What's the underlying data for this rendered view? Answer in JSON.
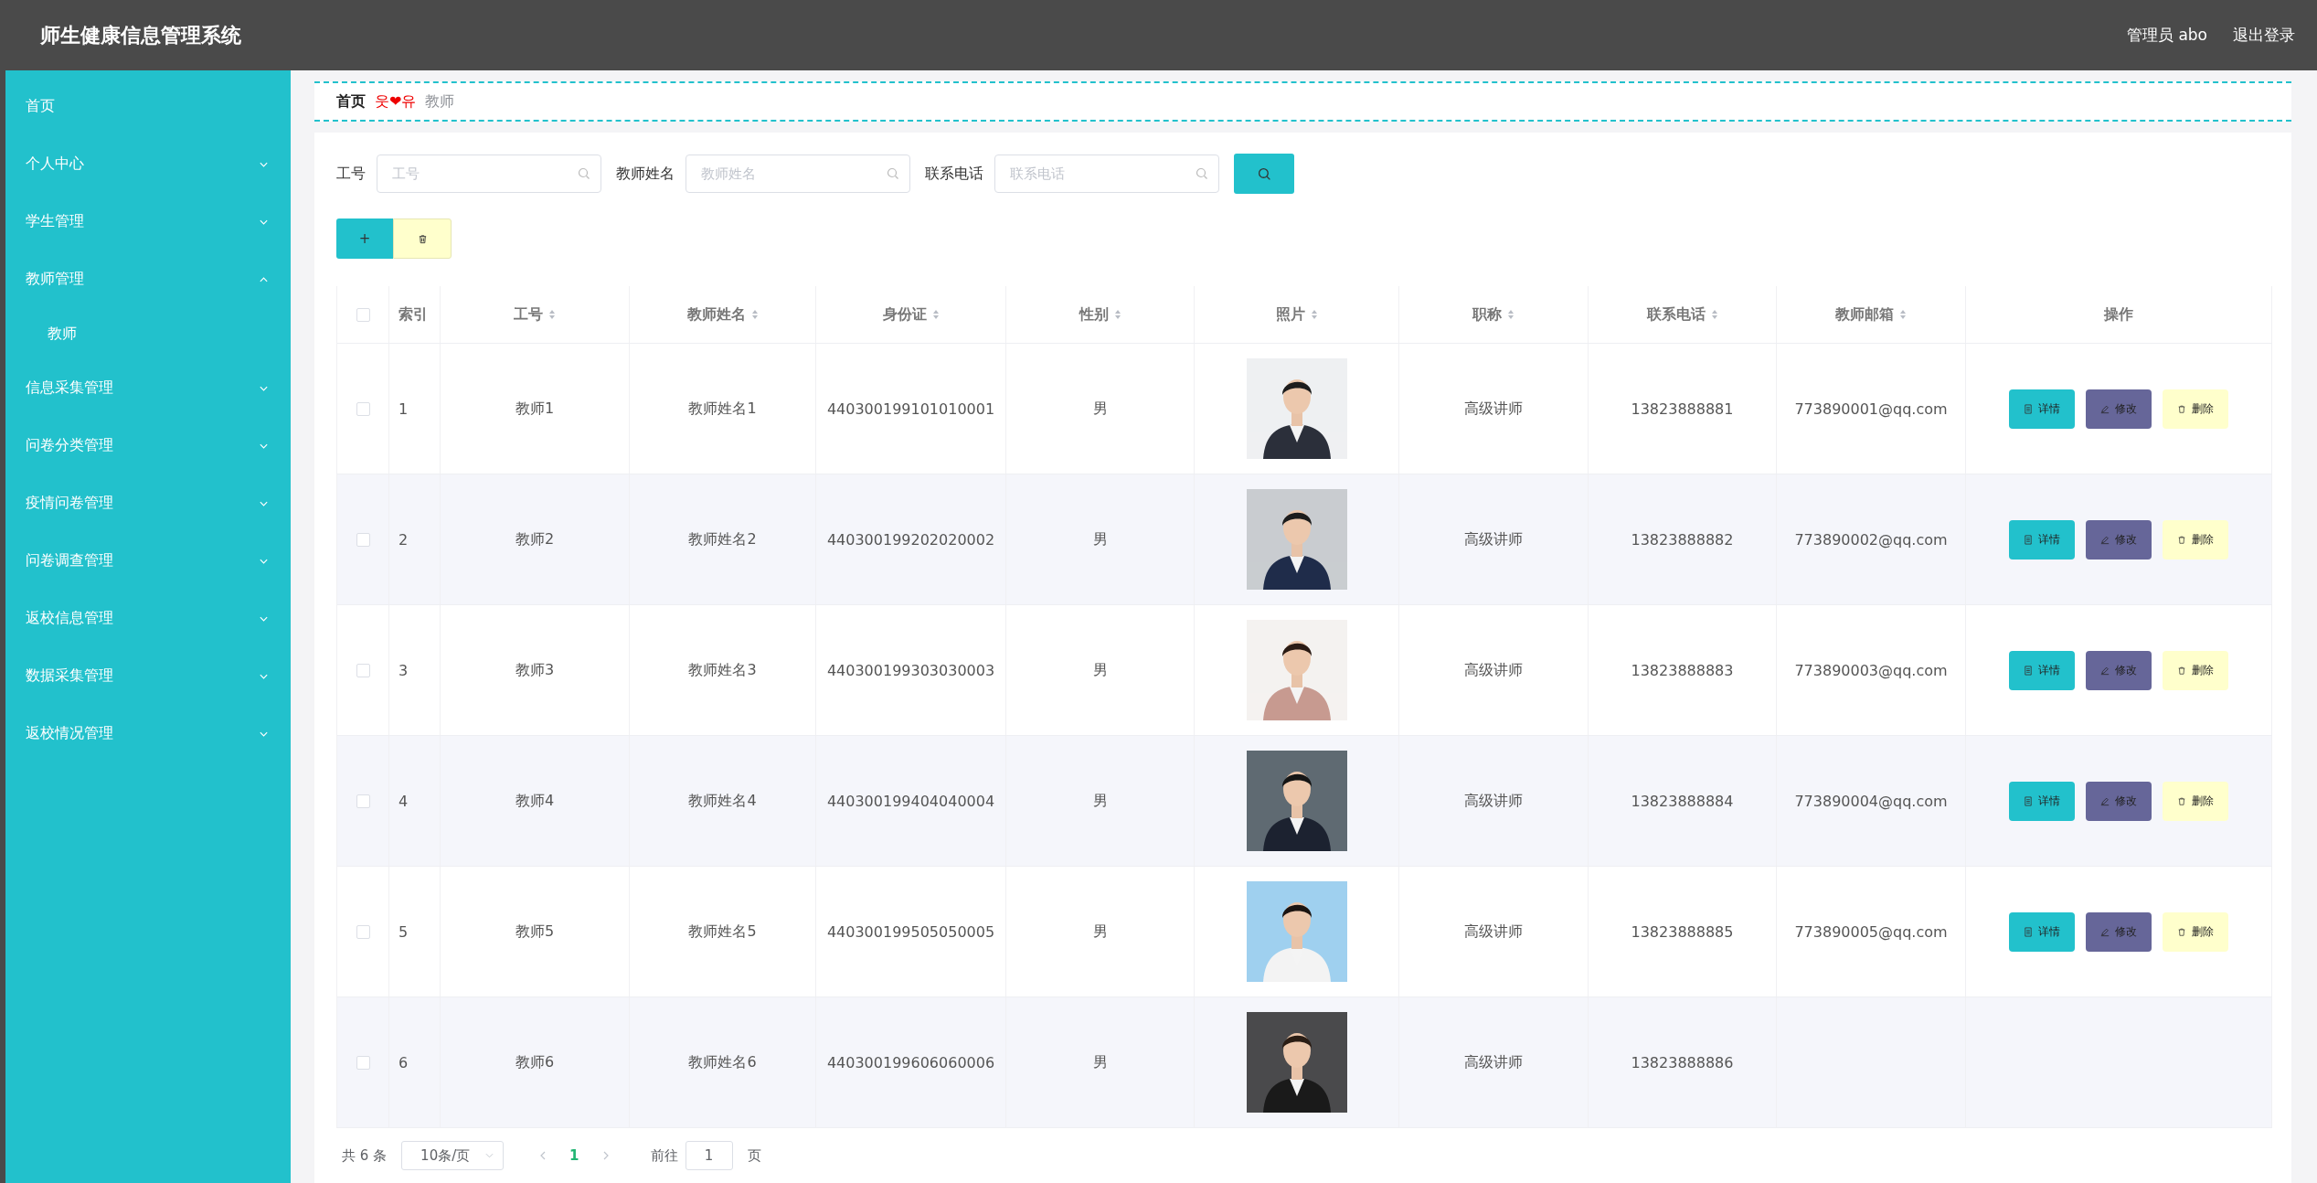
{
  "header": {
    "title": "师生健康信息管理系统",
    "user": "管理员 abo",
    "logout": "退出登录"
  },
  "sidebar": {
    "items": [
      {
        "label": "首页",
        "kind": "link"
      },
      {
        "label": "个人中心",
        "kind": "menu",
        "expanded": false
      },
      {
        "label": "学生管理",
        "kind": "menu",
        "expanded": false
      },
      {
        "label": "教师管理",
        "kind": "menu",
        "expanded": true,
        "children": [
          {
            "label": "教师"
          }
        ]
      },
      {
        "label": "信息采集管理",
        "kind": "menu",
        "expanded": false
      },
      {
        "label": "问卷分类管理",
        "kind": "menu",
        "expanded": false
      },
      {
        "label": "疫情问卷管理",
        "kind": "menu",
        "expanded": false
      },
      {
        "label": "问卷调查管理",
        "kind": "menu",
        "expanded": false
      },
      {
        "label": "返校信息管理",
        "kind": "menu",
        "expanded": false
      },
      {
        "label": "数据采集管理",
        "kind": "menu",
        "expanded": false
      },
      {
        "label": "返校情况管理",
        "kind": "menu",
        "expanded": false
      }
    ]
  },
  "breadcrumb": {
    "home": "首页",
    "separator": "웃❤유",
    "current": "教师"
  },
  "search": {
    "fields": [
      {
        "label": "工号",
        "placeholder": "工号"
      },
      {
        "label": "教师姓名",
        "placeholder": "教师姓名"
      },
      {
        "label": "联系电话",
        "placeholder": "联系电话"
      }
    ]
  },
  "toolbar": {
    "add": "+"
  },
  "table": {
    "header_checked": false,
    "index_label": "索引",
    "columns": [
      "工号",
      "教师姓名",
      "身份证",
      "性别",
      "照片",
      "职称",
      "联系电话",
      "教师邮箱"
    ],
    "actions_label": "操作",
    "rows": [
      {
        "checked": false,
        "index": "1",
        "id": "教师1",
        "name": "教师姓名1",
        "idcard": "440300199101010001",
        "gender": "男",
        "title": "高级讲师",
        "phone": "13823888881",
        "email": "773890001@qq.com",
        "actions": [
          "详情",
          "修改",
          "删除"
        ]
      },
      {
        "checked": false,
        "index": "2",
        "id": "教师2",
        "name": "教师姓名2",
        "idcard": "440300199202020002",
        "gender": "男",
        "title": "高级讲师",
        "phone": "13823888882",
        "email": "773890002@qq.com",
        "actions": [
          "详情",
          "修改",
          "删除"
        ]
      },
      {
        "checked": false,
        "index": "3",
        "id": "教师3",
        "name": "教师姓名3",
        "idcard": "440300199303030003",
        "gender": "男",
        "title": "高级讲师",
        "phone": "13823888883",
        "email": "773890003@qq.com",
        "actions": [
          "详情",
          "修改",
          "删除"
        ]
      },
      {
        "checked": false,
        "index": "4",
        "id": "教师4",
        "name": "教师姓名4",
        "idcard": "440300199404040004",
        "gender": "男",
        "title": "高级讲师",
        "phone": "13823888884",
        "email": "773890004@qq.com",
        "actions": [
          "详情",
          "修改",
          "删除"
        ]
      },
      {
        "checked": false,
        "index": "5",
        "id": "教师5",
        "name": "教师姓名5",
        "idcard": "440300199505050005",
        "gender": "男",
        "title": "高级讲师",
        "phone": "13823888885",
        "email": "773890005@qq.com",
        "actions": [
          "详情",
          "修改",
          "删除"
        ]
      },
      {
        "checked": false,
        "index": "6",
        "id": "教师6",
        "name": "教师姓名6",
        "idcard": "440300199606060006",
        "gender": "男",
        "title": "高级讲师",
        "phone": "13823888886"
      }
    ]
  },
  "pagination": {
    "total": "共 6 条",
    "page_size": "10条/页",
    "pages": [
      {
        "label": "1",
        "selected": true
      }
    ],
    "goto": "前往",
    "goto_value": "1",
    "page_unit": "页"
  }
}
